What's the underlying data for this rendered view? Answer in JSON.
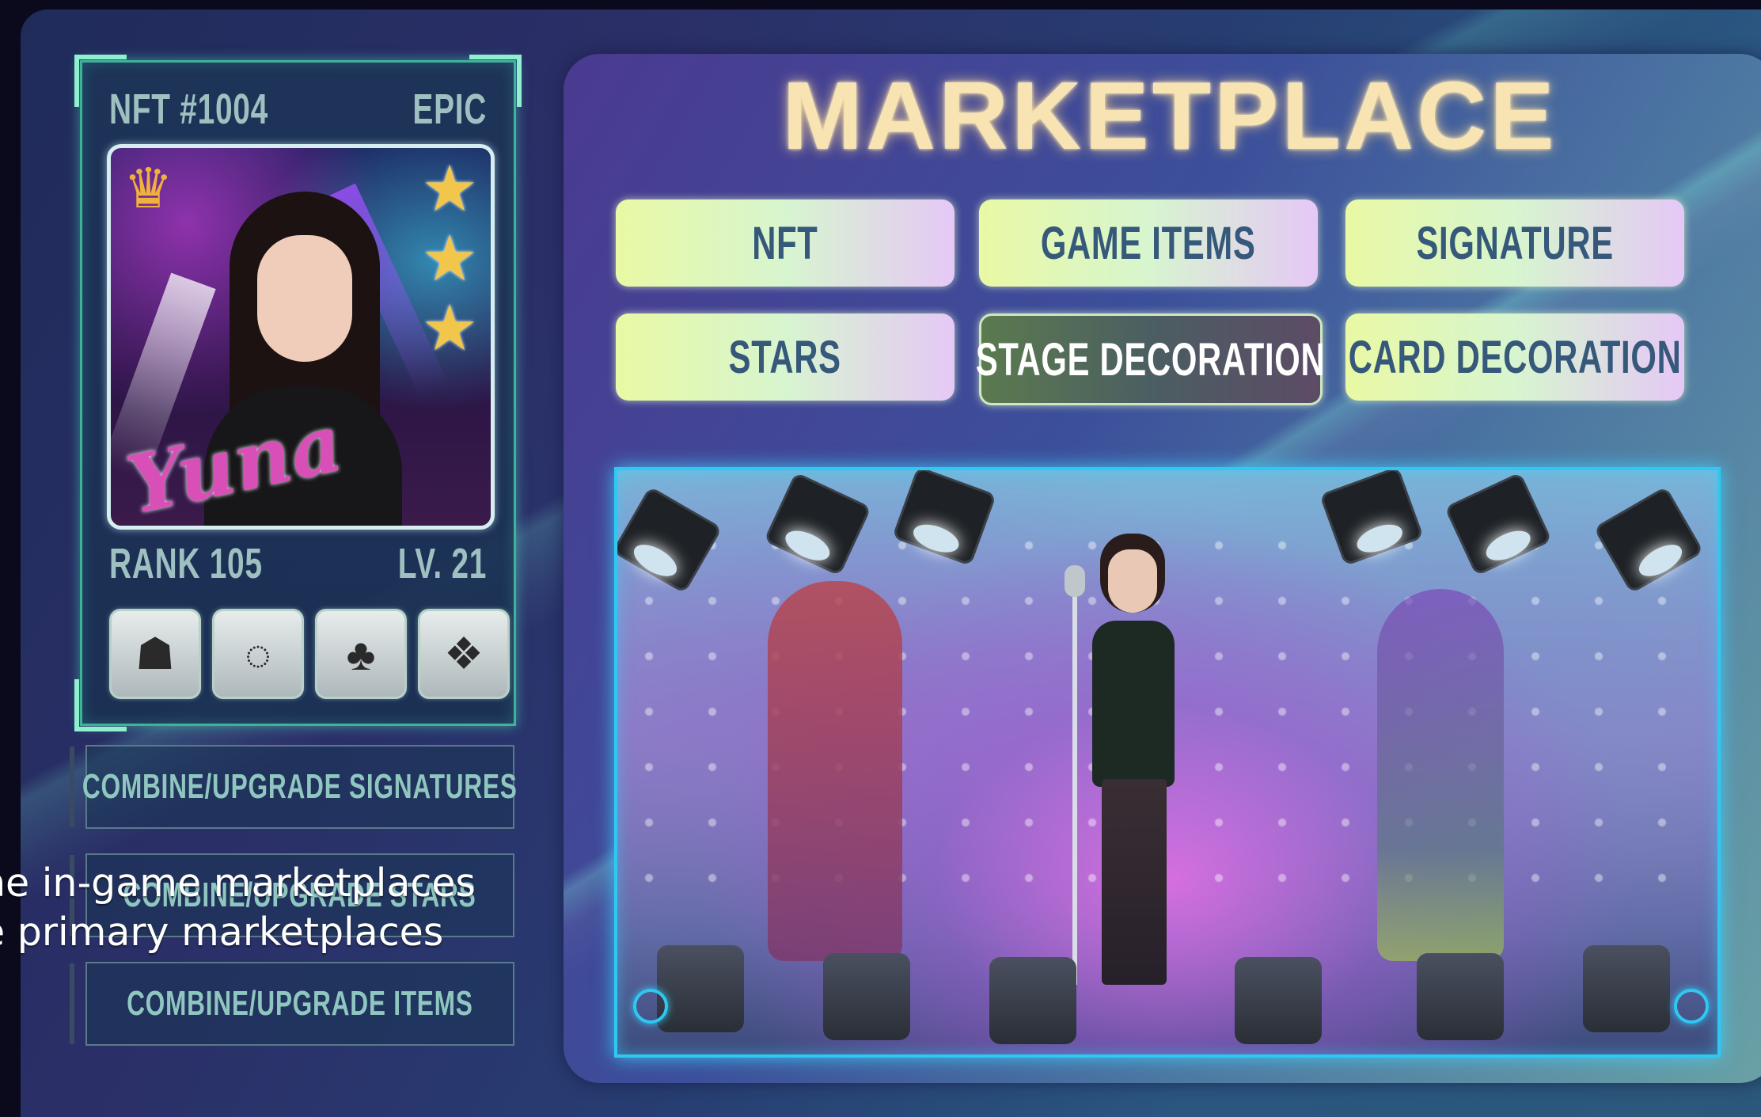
{
  "nft_card": {
    "id_label": "NFT #1004",
    "rarity": "EPIC",
    "rank_label": "RANK 105",
    "level_label": "LV. 21",
    "signature_text": "Yuna",
    "star_count": 3,
    "equipment": [
      {
        "name": "hair",
        "icon": "hair-icon"
      },
      {
        "name": "necklace",
        "icon": "necklace-icon"
      },
      {
        "name": "top",
        "icon": "top-icon"
      },
      {
        "name": "outfit",
        "icon": "outfit-icon"
      }
    ]
  },
  "side_actions": {
    "combine_signatures": "COMBINE/UPGRADE SIGNATURES",
    "combine_stars": "COMBINE/UPGRADE STARS",
    "combine_items": "COMBINE/UPGRADE ITEMS"
  },
  "subtitle": {
    "line1": "he in-game marketplaces",
    "line2": "e primary marketplaces"
  },
  "marketplace": {
    "title": "MARKETPLACE",
    "tabs": [
      {
        "label": "NFT",
        "active": false
      },
      {
        "label": "GAME ITEMS",
        "active": false
      },
      {
        "label": "SIGNATURE",
        "active": false
      },
      {
        "label": "STARS",
        "active": false
      },
      {
        "label": "STAGE DECORATION",
        "active": true
      },
      {
        "label": "CARD DECORATION",
        "active": false
      }
    ]
  },
  "colors": {
    "accent_cyan": "#2fc8f2",
    "title_gold": "#f7e4b2",
    "card_border": "#3fb39a"
  }
}
